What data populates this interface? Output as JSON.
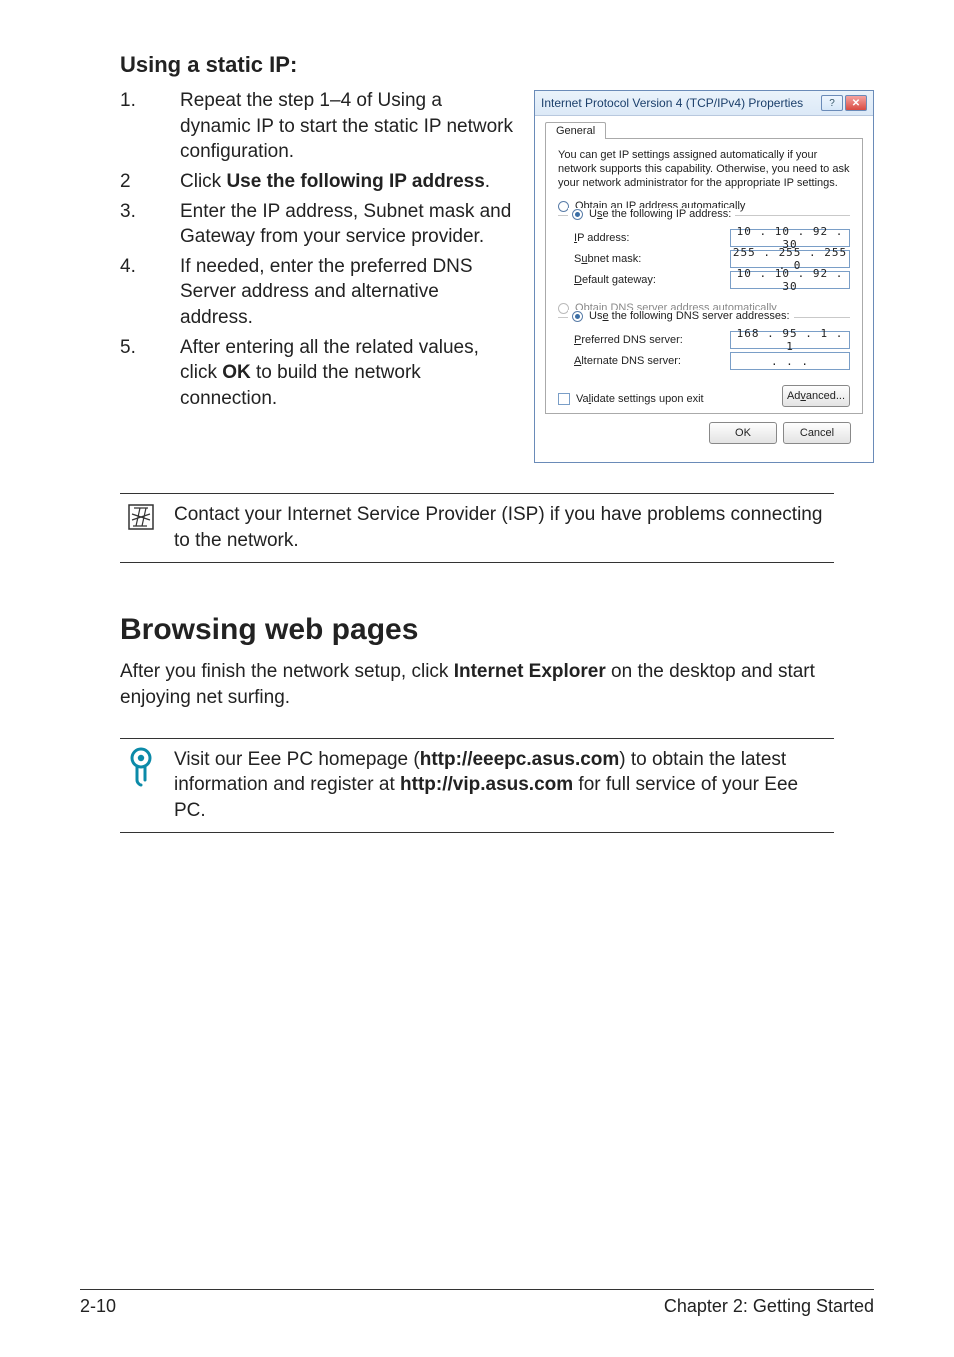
{
  "heading_static_ip": "Using a static IP:",
  "steps": [
    {
      "num": "1.",
      "text": "Repeat the step 1–4 of Using a dynamic IP to start the static IP network configuration."
    },
    {
      "num": "2",
      "prefix": "Click ",
      "bold": "Use the following IP address",
      "suffix": "."
    },
    {
      "num": "3.",
      "text": "Enter the IP address, Subnet mask and Gateway from your service provider."
    },
    {
      "num": "4.",
      "text": "If needed, enter the preferred DNS Server address and alternative address."
    },
    {
      "num": "5.",
      "prefix": "After entering all the related values, click ",
      "bold": "OK",
      "suffix": " to build the network connection."
    }
  ],
  "dialog": {
    "title": "Internet Protocol Version 4 (TCP/IPv4) Properties",
    "tab": "General",
    "description": "You can get IP settings assigned automatically if your network supports this capability. Otherwise, you need to ask your network administrator for the appropriate IP settings.",
    "radio_auto_ip": "Obtain an IP address automatically",
    "radio_use_ip": "Use the following IP address:",
    "ip_label": "IP address:",
    "ip_value": "10 . 10 . 92 . 30",
    "subnet_label": "Subnet mask:",
    "subnet_value": "255 . 255 . 255 .  0",
    "gateway_label": "Default gateway:",
    "gateway_value": "10 . 10 . 92 . 30",
    "radio_auto_dns": "Obtain DNS server address automatically",
    "radio_use_dns": "Use the following DNS server addresses:",
    "pref_dns_label": "Preferred DNS server:",
    "pref_dns_value": "168 . 95 .  1 .  1",
    "alt_dns_label": "Alternate DNS server:",
    "alt_dns_value": ".      .      .",
    "validate": "Validate settings upon exit",
    "advanced": "Advanced...",
    "ok": "OK",
    "cancel": "Cancel"
  },
  "note_isp": "Contact your Internet Service Provider (ISP) if you have problems connecting to the network.",
  "browsing_heading": "Browsing web pages",
  "browsing_para_prefix": "After you finish the network setup, click ",
  "browsing_para_bold": "Internet Explorer",
  "browsing_para_suffix": " on the desktop and start enjoying net surfing.",
  "tip": {
    "p1": "Visit our Eee PC homepage (",
    "b1": "http://eeepc.asus.com",
    "p2": ") to obtain the latest information and register at ",
    "b2": "http://vip.asus.com",
    "p3": " for full service of your Eee PC."
  },
  "footer_left": "2-10",
  "footer_right": "Chapter 2: Getting Started"
}
